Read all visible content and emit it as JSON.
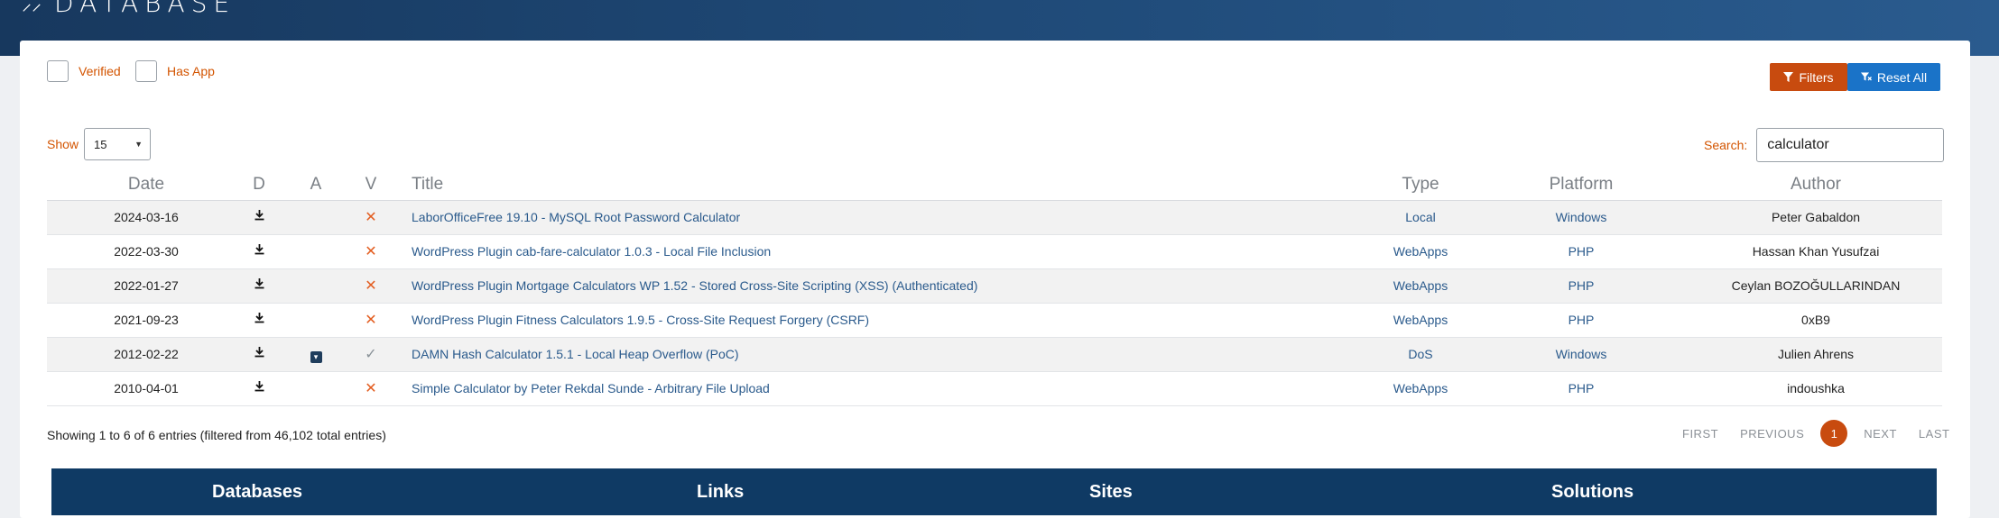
{
  "brand": {
    "title": "DATABASE"
  },
  "filters": {
    "verified_label": "Verified",
    "has_app_label": "Has App",
    "filters_button": "Filters",
    "reset_button": "Reset All"
  },
  "controls": {
    "show_label": "Show",
    "show_value": "15",
    "search_label": "Search:",
    "search_value": "calculator"
  },
  "table": {
    "headers": {
      "date": "Date",
      "d": "D",
      "a": "A",
      "v": "V",
      "title": "Title",
      "type": "Type",
      "platform": "Platform",
      "author": "Author"
    },
    "rows": [
      {
        "date": "2024-03-16",
        "has_app": false,
        "verified": false,
        "title": "LaborOfficeFree 19.10 - MySQL Root Password Calculator",
        "type": "Local",
        "platform": "Windows",
        "author": "Peter Gabaldon"
      },
      {
        "date": "2022-03-30",
        "has_app": false,
        "verified": false,
        "title": "WordPress Plugin cab-fare-calculator 1.0.3 - Local File Inclusion",
        "type": "WebApps",
        "platform": "PHP",
        "author": "Hassan Khan Yusufzai"
      },
      {
        "date": "2022-01-27",
        "has_app": false,
        "verified": false,
        "title": "WordPress Plugin Mortgage Calculators WP 1.52 - Stored Cross-Site Scripting (XSS) (Authenticated)",
        "type": "WebApps",
        "platform": "PHP",
        "author": "Ceylan BOZOĞULLARINDAN"
      },
      {
        "date": "2021-09-23",
        "has_app": false,
        "verified": false,
        "title": "WordPress Plugin Fitness Calculators 1.9.5 - Cross-Site Request Forgery (CSRF)",
        "type": "WebApps",
        "platform": "PHP",
        "author": "0xB9"
      },
      {
        "date": "2012-02-22",
        "has_app": true,
        "verified": true,
        "title": "DAMN Hash Calculator 1.5.1 - Local Heap Overflow (PoC)",
        "type": "DoS",
        "platform": "Windows",
        "author": "Julien Ahrens"
      },
      {
        "date": "2010-04-01",
        "has_app": false,
        "verified": false,
        "title": "Simple Calculator by Peter Rekdal Sunde - Arbitrary File Upload",
        "type": "WebApps",
        "platform": "PHP",
        "author": "indoushka"
      }
    ]
  },
  "info": {
    "text": "Showing 1 to 6 of 6 entries (filtered from 46,102 total entries)"
  },
  "pagination": {
    "first": "FIRST",
    "previous": "PREVIOUS",
    "current": "1",
    "next": "NEXT",
    "last": "LAST"
  },
  "footer": {
    "databases": "Databases",
    "links": "Links",
    "sites": "Sites",
    "solutions": "Solutions"
  },
  "colors": {
    "accent": "#c84b0f",
    "link": "#2a5a8c",
    "reset": "#1a73c8",
    "banner": "#17385e",
    "footer": "#0f3a64"
  },
  "icons": {
    "download": "download-icon",
    "app": "app-icon",
    "unverified": "x-icon",
    "verified": "check-icon",
    "filter": "filter-icon",
    "reset": "filter-reset-icon"
  }
}
